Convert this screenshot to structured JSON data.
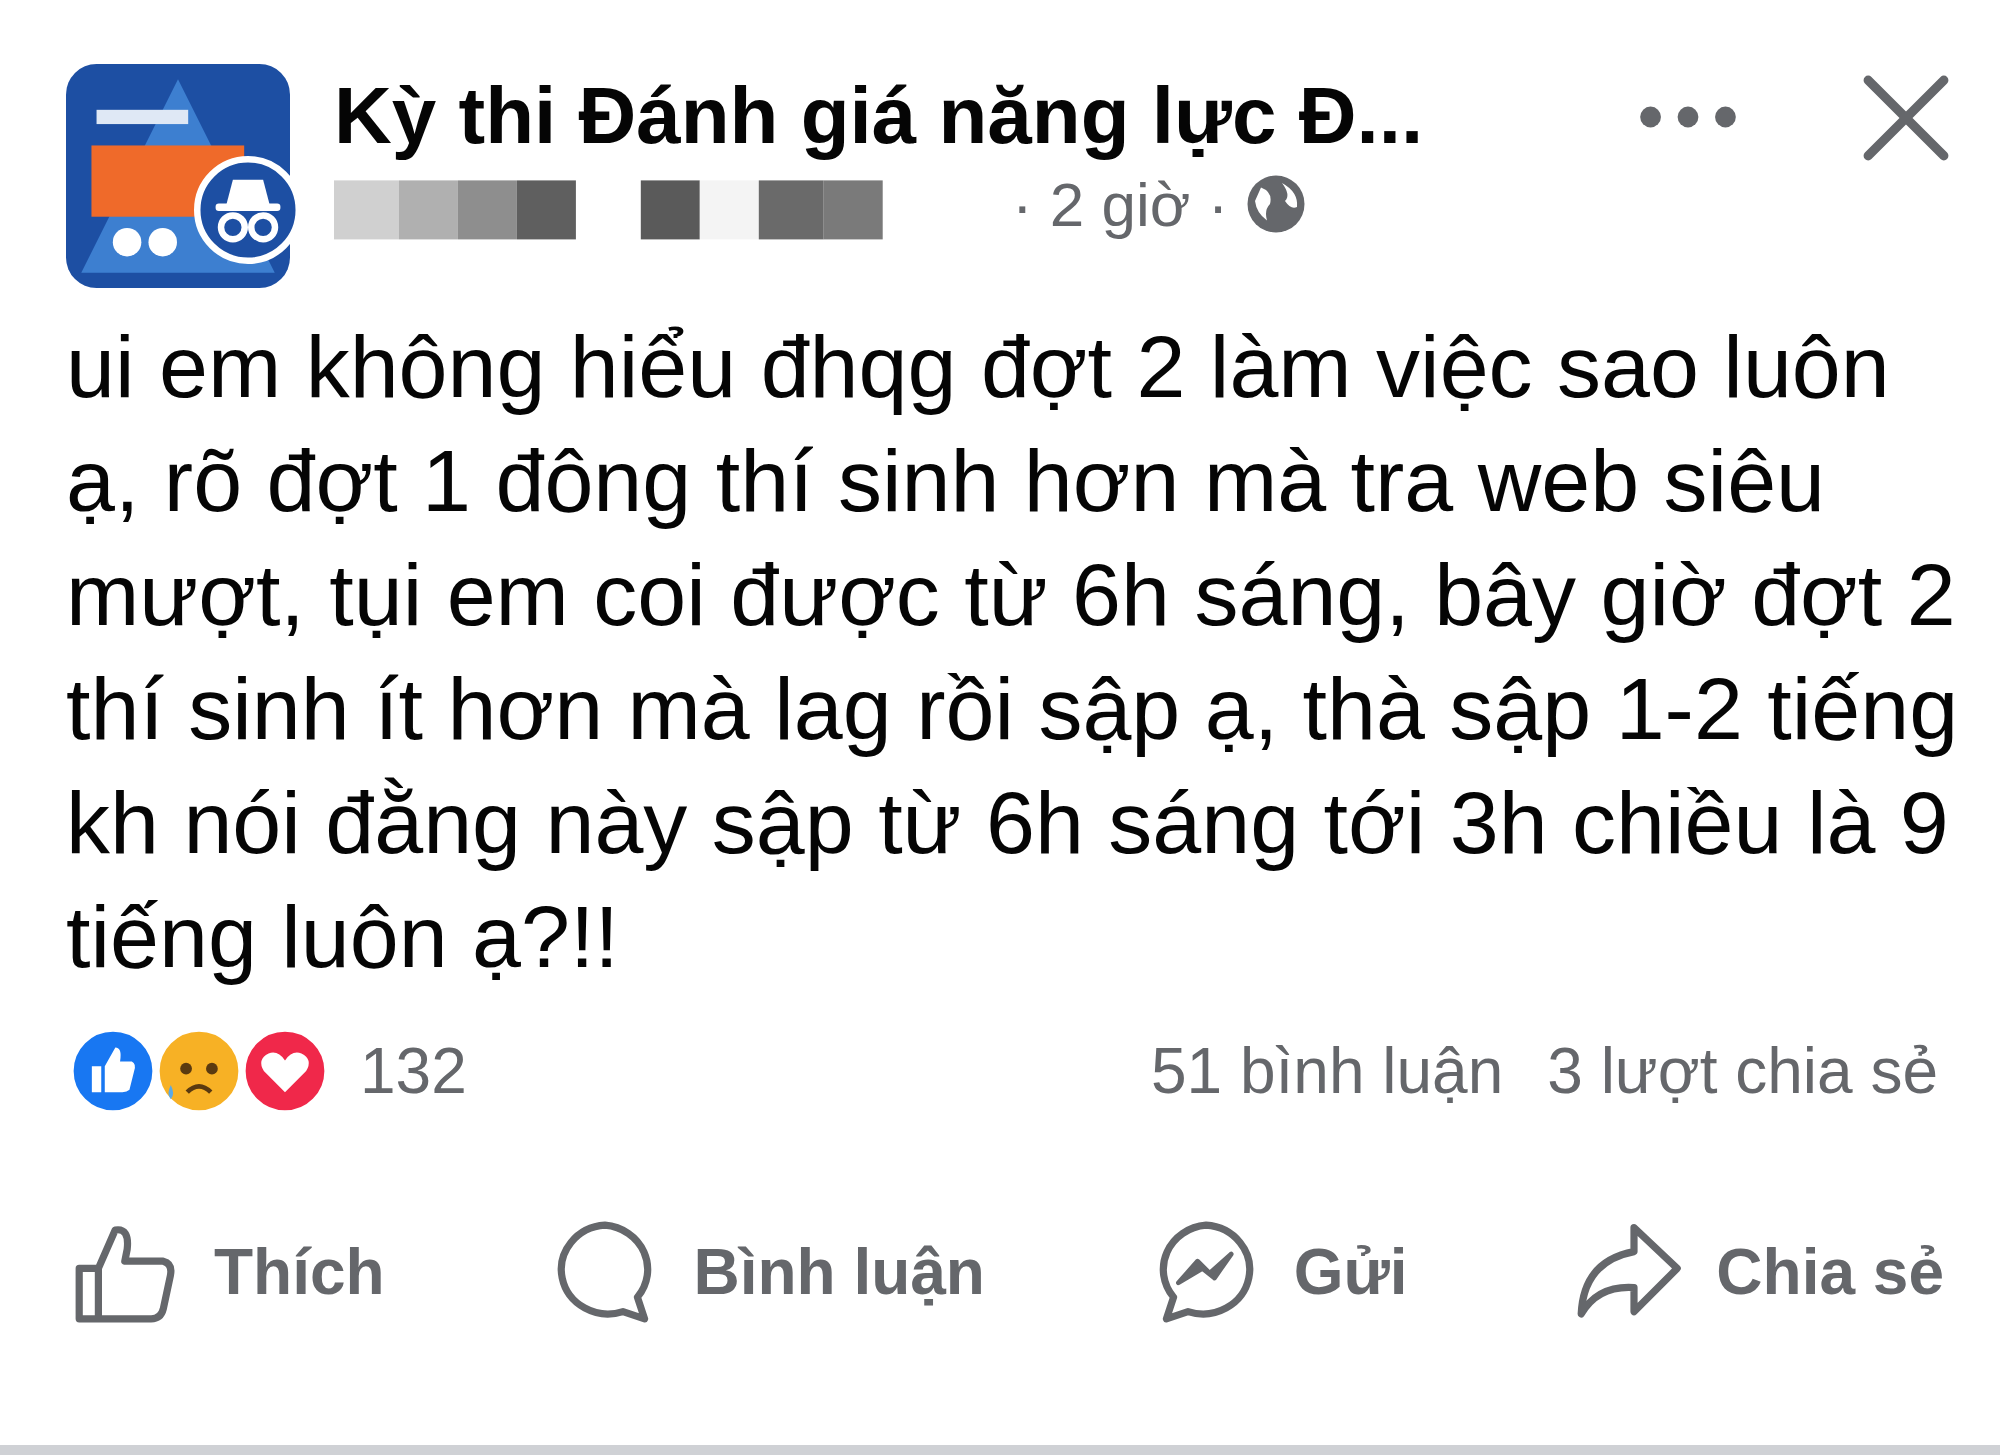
{
  "post": {
    "page_name": "Kỳ thi Đánh giá năng lực Đ...",
    "time": "· 2 giờ ·",
    "body": "ui em không hiểu đhqg đợt 2 làm việc sao luôn ạ, rõ đợt 1 đông thí sinh hơn mà tra web siêu mượt, tụi em coi được từ 6h sáng, bây giờ đợt 2 thí sinh ít hơn mà lag rồi sập ạ, thà sập 1-2 tiếng kh nói đằng này sập từ 6h sáng tới 3h chiều là 9 tiếng luôn ạ?!!"
  },
  "stats": {
    "reactions": "132",
    "comments": "51 bình luận",
    "shares": "3 lượt chia sẻ"
  },
  "actions": [
    {
      "kind": "like",
      "label": "Thích"
    },
    {
      "kind": "comment",
      "label": "Bình luận"
    },
    {
      "kind": "send",
      "label": "Gửi"
    },
    {
      "kind": "share",
      "label": "Chia sẻ"
    }
  ]
}
